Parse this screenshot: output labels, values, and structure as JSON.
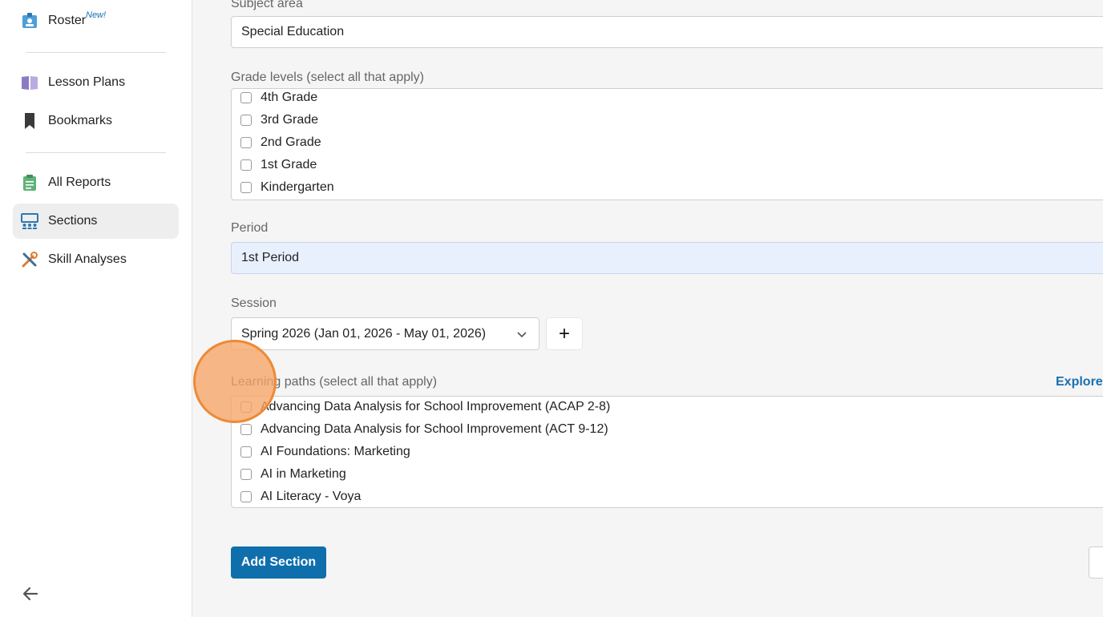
{
  "sidebar": {
    "roster": {
      "label": "Roster",
      "badge": "New!"
    },
    "lesson_plans": {
      "label": "Lesson Plans"
    },
    "bookmarks": {
      "label": "Bookmarks"
    },
    "all_reports": {
      "label": "All Reports"
    },
    "sections": {
      "label": "Sections"
    },
    "skill_analyses": {
      "label": "Skill Analyses"
    }
  },
  "form": {
    "subject_area": {
      "label": "Subject area",
      "value": "Special Education"
    },
    "grade_levels": {
      "label": "Grade levels (select all that apply)",
      "options": [
        "4th Grade",
        "3rd Grade",
        "2nd Grade",
        "1st Grade",
        "Kindergarten"
      ]
    },
    "period": {
      "label": "Period",
      "value": "1st Period"
    },
    "session": {
      "label": "Session",
      "value": "Spring 2026 (Jan 01, 2026 - May 01, 2026)",
      "add_label": "+"
    },
    "learning_paths": {
      "label": "Learning paths (select all that apply)",
      "explore_link": "Explore",
      "options": [
        "Advancing Data Analysis for School Improvement (ACAP 2-8)",
        "Advancing Data Analysis for School Improvement (ACT 9-12)",
        "AI Foundations: Marketing",
        "AI in Marketing",
        "AI Literacy - Voya"
      ]
    },
    "submit_label": "Add Section"
  },
  "colors": {
    "primary": "#0f6fad",
    "cursor_highlight": "#f6a466",
    "active_nav": "#eeeeee"
  }
}
